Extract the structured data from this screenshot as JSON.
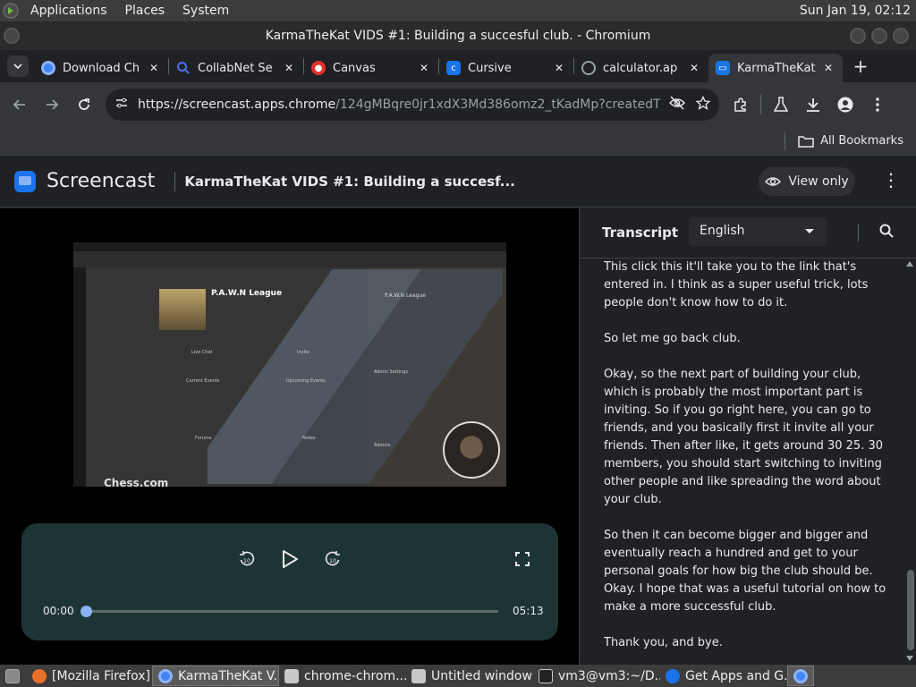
{
  "os_panel": {
    "menus": [
      "Applications",
      "Places",
      "System"
    ],
    "clock": "Sun Jan 19, 02:12"
  },
  "window": {
    "title": "KarmaTheKat VIDS #1: Building a succesful club. - Chromium"
  },
  "tabs": [
    {
      "title": "Download Ch",
      "icon": "chrome-icon",
      "color": "#4285f4"
    },
    {
      "title": "CollabNet Se",
      "icon": "search-icon",
      "color": "#4c6ef5"
    },
    {
      "title": "Canvas",
      "icon": "canvas-icon",
      "color": "#e03131"
    },
    {
      "title": "Cursive",
      "icon": "cursive-icon",
      "color": "#1a73e8"
    },
    {
      "title": "calculator.ap",
      "icon": "globe-icon",
      "color": "#9aa0a6"
    },
    {
      "title": "KarmaTheKat",
      "icon": "screencast-icon",
      "color": "#1a73e8"
    }
  ],
  "toolbar": {
    "url_host": "https://screencast.apps.chrome",
    "url_path": "/124gMBqre0jr1xdX3Md386omz2_tKadMp?createdTime=20..."
  },
  "bookmarks": {
    "all_label": "All Bookmarks"
  },
  "app": {
    "brand": "Screencast",
    "title": "KarmaTheKat VIDS #1: Building a succesf...",
    "view_only_label": "View only"
  },
  "video": {
    "overlay": {
      "club_name": "P.A.W.N League",
      "club_name_side": "P.A.W.N League",
      "live_chat": "Live Chat",
      "invite": "Invite",
      "current_events": "Current Events",
      "upcoming_events": "Upcoming Events",
      "forums": "Forums",
      "notes": "Notes",
      "admin_settings": "Admin Settings",
      "admins": "Admins",
      "chess_logo": "Chess.com"
    }
  },
  "player": {
    "current_time": "00:00",
    "duration": "05:13",
    "progress": 0.0
  },
  "transcript": {
    "title": "Transcript",
    "language": "English",
    "paragraphs": [
      "This click this it'll take you to the link that's entered in. I think as a super useful trick, lots people don't know how to do it.",
      "So let me go back club.",
      "Okay, so the next part of building your club, which is probably the most important part is inviting. So if you go right here, you can go to friends, and you basically first it invite all your friends. Then after like, it gets around 30 25. 30 members, you should start switching to inviting other people and like spreading the word about your club.",
      "So then it can become bigger and bigger and eventually reach a hundred and get to your personal goals for how big the club should be. Okay. I hope that was a useful tutorial on how to make a more successful club.",
      "Thank you, and bye."
    ]
  },
  "taskbar": [
    {
      "label": "[Mozilla Firefox]",
      "icon": "firefox-icon",
      "color": "#e8722c"
    },
    {
      "label": "KarmaTheKat V...",
      "icon": "chromium-icon",
      "color": "#4285f4",
      "active": true
    },
    {
      "label": "chrome-chrom...",
      "icon": "folder-icon",
      "color": "#c8c8c8"
    },
    {
      "label": "Untitled window",
      "icon": "window-icon",
      "color": "#c8c8c8"
    },
    {
      "label": "vm3@vm3:~/D...",
      "icon": "terminal-icon",
      "color": "#c8c8c8"
    },
    {
      "label": "Get Apps and G...",
      "icon": "chrome-icon",
      "color": "#1a73e8"
    }
  ]
}
